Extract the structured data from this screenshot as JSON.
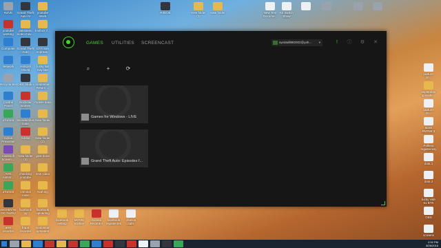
{
  "desktop": {
    "left_icons": [
      {
        "label": "RZVE",
        "color": "c-grey"
      },
      {
        "label": "Grand Theft Auto IV",
        "color": "c-dark"
      },
      {
        "label": "youtube Work",
        "color": "c-yellow"
      },
      {
        "label": "youtube working 2016",
        "color": "c-red"
      },
      {
        "label": "pakistanu video mov...",
        "color": "c-yellow"
      },
      {
        "label": "toolbox 7...",
        "color": "c-yellow"
      },
      {
        "label": "Computer",
        "color": "c-blue"
      },
      {
        "label": "Grand Theft Auto Episod...",
        "color": "c-dark"
      },
      {
        "label": "GTA San Andreas - ...",
        "color": "c-dark"
      },
      {
        "label": "Network",
        "color": "c-blue"
      },
      {
        "label": "Hotspot Shield",
        "color": "c-blue"
      },
      {
        "label": "lucky sat tray f&e ready ...",
        "color": "c-yellow"
      },
      {
        "label": "Recycle Bin",
        "color": "c-grey"
      },
      {
        "label": "OBS Studio",
        "color": "c-dark"
      },
      {
        "label": "madasnan Return ...",
        "color": "c-yellow"
      },
      {
        "label": "Control Panel",
        "color": "c-blue"
      },
      {
        "label": "Rockstar Games Soci...",
        "color": "c-red"
      },
      {
        "label": "mobile data",
        "color": "c-yellow"
      },
      {
        "label": "uTorrent",
        "color": "c-green"
      },
      {
        "label": "Wondershare Data Recov...",
        "color": "c-blue"
      },
      {
        "label": "New folder",
        "color": "c-yellow"
      },
      {
        "label": "Active Presenter",
        "color": "c-blue"
      },
      {
        "label": "Adobe",
        "color": "c-red"
      },
      {
        "label": "New folder (2)",
        "color": "c-yellow"
      },
      {
        "label": "Aiseesoft Screen ...",
        "color": "c-purple"
      },
      {
        "label": "New folder (4)",
        "color": "c-yellow"
      },
      {
        "label": "gest done",
        "color": "c-yellow"
      },
      {
        "label": "AVG AntiVir...",
        "color": "c-green"
      },
      {
        "label": "checking youtube",
        "color": "c-yellow"
      },
      {
        "label": "new video",
        "color": "c-yellow"
      },
      {
        "label": "uTorrent",
        "color": "c-green"
      },
      {
        "label": "criminal case world.page",
        "color": "c-yellow"
      },
      {
        "label": "Nothing",
        "color": "c-yellow"
      },
      {
        "label": "GIGABYTE OC GURU",
        "color": "c-dark"
      },
      {
        "label": "facebook pg",
        "color": "c-yellow"
      },
      {
        "label": "facebook uploading",
        "color": "c-yellow"
      },
      {
        "label": "ares recorder",
        "color": "c-red"
      },
      {
        "label": "frapa recorder",
        "color": "c-yellow"
      },
      {
        "label": "madasnan uploaded",
        "color": "c-yellow"
      }
    ],
    "top_icons": [
      {
        "label": "RIIDOE",
        "color": "c-dark"
      },
      {
        "label": "New folder (3)",
        "color": "c-yellow"
      },
      {
        "label": "New folder",
        "color": "c-yellow"
      },
      {
        "label": "New Text Docume...",
        "color": "c-white"
      },
      {
        "label": "Kit Switch Show App...",
        "color": "c-white"
      },
      {
        "label": "",
        "color": "c-white"
      },
      {
        "label": "",
        "color": "c-grey"
      },
      {
        "label": "",
        "color": "c-grey"
      },
      {
        "label": "",
        "color": "c-grey"
      }
    ],
    "right_icons": [
      {
        "label": "capture-20...",
        "color": "c-white"
      },
      {
        "label": "september uploadin...",
        "color": "c-yellow"
      },
      {
        "label": "capture-20...",
        "color": "c-white"
      },
      {
        "label": "Mass FNTNE 3 2016-09...",
        "color": "c-white"
      },
      {
        "label": "Pollena register.key 2",
        "color": "c-white"
      },
      {
        "label": "data 1",
        "color": "c-white"
      },
      {
        "label": "data 2",
        "color": "c-white"
      },
      {
        "label": "lucky vide 51 BTK dun...",
        "color": "c-white"
      },
      {
        "label": "OBS",
        "color": "c-white"
      },
      {
        "label": "screens",
        "color": "c-white"
      }
    ],
    "bottom_icons": [
      {
        "label": "facebook setting",
        "color": "c-yellow"
      },
      {
        "label": "MOVIE Stickter",
        "color": "c-yellow"
      },
      {
        "label": "Screen Recorder",
        "color": "c-red"
      },
      {
        "label": "facebook register.tes",
        "color": "c-white"
      },
      {
        "label": "chance calls Annie...",
        "color": "c-white"
      }
    ]
  },
  "app": {
    "tabs": [
      "GAMES",
      "UTILITIES",
      "SCREENCAST"
    ],
    "active_tab": "GAMES",
    "account_email": "syedadil882002@yah...",
    "tools": {
      "search": "⌕",
      "add": "+",
      "refresh": "⟳"
    },
    "games": [
      {
        "title": "Games for Windows - LIVE"
      },
      {
        "title": "Grand Theft Auto: Episodes f..."
      }
    ],
    "accent_color": "#44d62c"
  },
  "taskbar": {
    "time": "2:32 PM",
    "date": "8/26/2016"
  }
}
